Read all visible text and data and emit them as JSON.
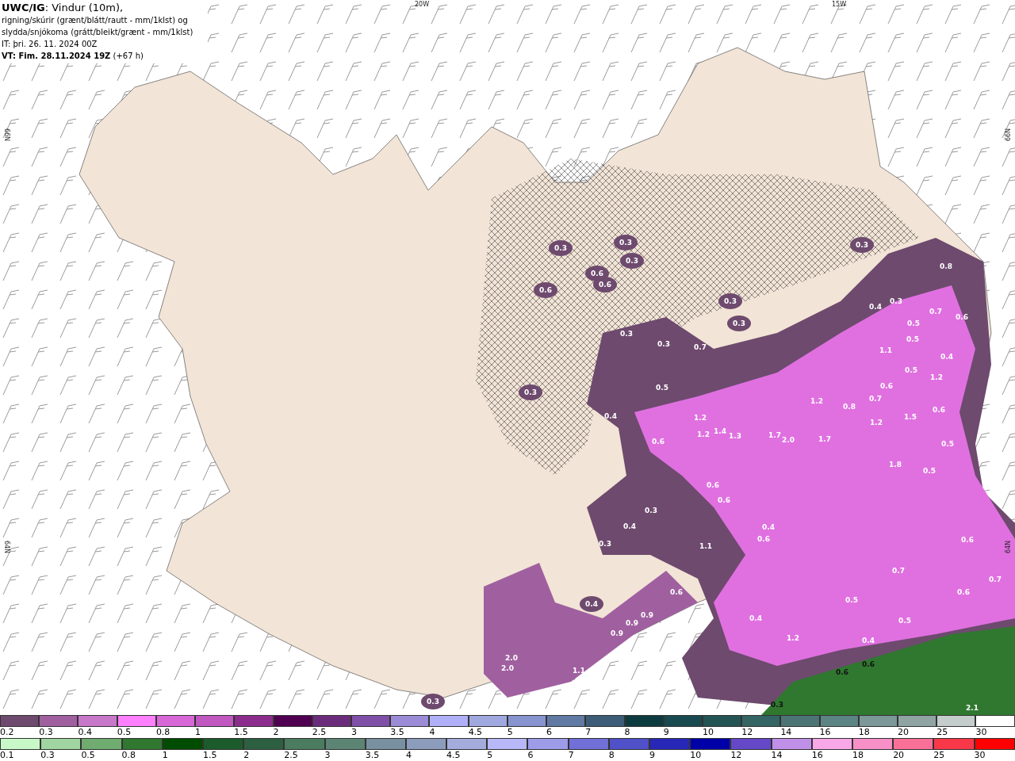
{
  "header": {
    "lines": [
      "**UWC/IG**: Vindur (10m),",
      "rigning/skúrir (grænt/blátt/rautt - mm/1klst) og",
      "slydda/snjókoma (grátt/bleikt/grænt - mm/1klst)",
      "IT: þri. 26. 11. 2024 00Z",
      "**VT: Fim. 28.11.2024 19Z** (+67 h)"
    ]
  },
  "map": {
    "grid_labels": [
      "20W",
      "15W",
      "66N",
      "64N",
      "66N",
      "64N"
    ],
    "values": [
      "0.3",
      "0.3",
      "0.3",
      "0.6",
      "0.6",
      "0.6",
      "0.3",
      "0.3",
      "0.3",
      "0.3",
      "0.7",
      "0.3",
      "0.5",
      "0.4",
      "0.6",
      "1.2",
      "1.2",
      "1.4",
      "1.3",
      "1.7",
      "2.0",
      "1.7",
      "0.4",
      "0.3",
      "0.3",
      "0.8",
      "0.7",
      "0.6",
      "0.5",
      "0.5",
      "1.1",
      "0.4",
      "0.5",
      "1.2",
      "0.6",
      "1.2",
      "0.8",
      "0.7",
      "1.2",
      "1.5",
      "0.6",
      "0.5",
      "1.8",
      "0.5",
      "0.6",
      "0.6",
      "0.3",
      "0.4",
      "0.3",
      "1.1",
      "0.4",
      "0.6",
      "0.7",
      "0.6",
      "0.7",
      "0.6",
      "0.5",
      "0.5",
      "0.4",
      "1.2",
      "0.4",
      "0.9",
      "0.9",
      "0.9",
      "0.6",
      "0.4",
      "2.0",
      "2.0",
      "1.1",
      "0.3",
      "0.6",
      "0.6",
      "2.1",
      "0.3"
    ]
  },
  "legends": [
    {
      "items": [
        {
          "label": "0.2",
          "color": "#6e4a6e"
        },
        {
          "label": "0.3",
          "color": "#a060a0"
        },
        {
          "label": "0.4",
          "color": "#c878c8"
        },
        {
          "label": "0.5",
          "color": "#ff80ff"
        },
        {
          "label": "0.8",
          "color": "#d868d8"
        },
        {
          "label": "1",
          "color": "#c058c0"
        },
        {
          "label": "1.5",
          "color": "#8c2c8c"
        },
        {
          "label": "2",
          "color": "#500050"
        },
        {
          "label": "2.5",
          "color": "#6c2c7c"
        },
        {
          "label": "3",
          "color": "#8050a8"
        },
        {
          "label": "3.5",
          "color": "#9c8cd8"
        },
        {
          "label": "4",
          "color": "#b0b0f8"
        },
        {
          "label": "4.5",
          "color": "#a0a8e0"
        },
        {
          "label": "5",
          "color": "#8894d0"
        },
        {
          "label": "6",
          "color": "#607aa4"
        },
        {
          "label": "7",
          "color": "#3c5c78"
        },
        {
          "label": "8",
          "color": "#0c3c40"
        },
        {
          "label": "9",
          "color": "#184a50"
        },
        {
          "label": "10",
          "color": "#245454"
        },
        {
          "label": "12",
          "color": "#346464"
        },
        {
          "label": "14",
          "color": "#4c7474"
        },
        {
          "label": "16",
          "color": "#5c8484"
        },
        {
          "label": "18",
          "color": "#7c9898"
        },
        {
          "label": "20",
          "color": "#90a4a4"
        },
        {
          "label": "25",
          "color": "#c4cccc"
        },
        {
          "label": "30",
          "color": "#ffffff"
        }
      ]
    },
    {
      "items": [
        {
          "label": "0.1",
          "color": "#c8f8c8"
        },
        {
          "label": "0.3",
          "color": "#a0d4a0"
        },
        {
          "label": "0.5",
          "color": "#70ac70"
        },
        {
          "label": "0.8",
          "color": "#307830"
        },
        {
          "label": "1",
          "color": "#004c00"
        },
        {
          "label": "1.5",
          "color": "#1c5c2c"
        },
        {
          "label": "2",
          "color": "#2c6040"
        },
        {
          "label": "2.5",
          "color": "#4c7c60"
        },
        {
          "label": "3",
          "color": "#5c8474"
        },
        {
          "label": "3.5",
          "color": "#7890a0"
        },
        {
          "label": "4",
          "color": "#8c9cbc"
        },
        {
          "label": "4.5",
          "color": "#a4acdc"
        },
        {
          "label": "5",
          "color": "#b8b8f8"
        },
        {
          "label": "6",
          "color": "#9c9ce8"
        },
        {
          "label": "7",
          "color": "#7070d8"
        },
        {
          "label": "8",
          "color": "#5050c8"
        },
        {
          "label": "9",
          "color": "#2828b8"
        },
        {
          "label": "10",
          "color": "#0000a8"
        },
        {
          "label": "12",
          "color": "#6448c8"
        },
        {
          "label": "14",
          "color": "#c090e8"
        },
        {
          "label": "16",
          "color": "#f8a8e8"
        },
        {
          "label": "18",
          "color": "#f890c8"
        },
        {
          "label": "20",
          "color": "#f87098"
        },
        {
          "label": "25",
          "color": "#f83848"
        },
        {
          "label": "30",
          "color": "#ff0000"
        }
      ]
    }
  ]
}
